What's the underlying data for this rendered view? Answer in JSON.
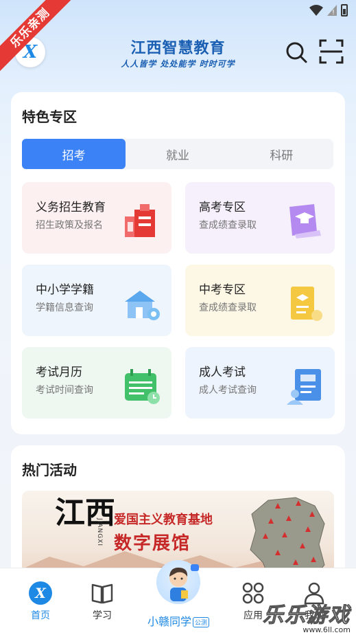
{
  "ribbon": "乐乐亲测",
  "header": {
    "title": "江西智慧教育",
    "slogan": "人人皆学 处处能学 时时可学",
    "logo_glyph": "X"
  },
  "features": {
    "title": "特色专区",
    "tabs": [
      {
        "label": "招考",
        "active": true
      },
      {
        "label": "就业",
        "active": false
      },
      {
        "label": "科研",
        "active": false
      }
    ],
    "tiles": [
      {
        "title": "义务招生教育",
        "subtitle": "招生政策及报名",
        "icon": "school-building-icon"
      },
      {
        "title": "高考专区",
        "subtitle": "查成绩查录取",
        "icon": "graduation-book-icon"
      },
      {
        "title": "中小学学籍",
        "subtitle": "学籍信息查询",
        "icon": "house-icon"
      },
      {
        "title": "中考专区",
        "subtitle": "查成绩查录取",
        "icon": "certificate-icon"
      },
      {
        "title": "考试月历",
        "subtitle": "考试时间查询",
        "icon": "calendar-icon"
      },
      {
        "title": "成人考试",
        "subtitle": "成人考试查询",
        "icon": "id-card-icon"
      }
    ]
  },
  "hot": {
    "title": "热门活动",
    "banner": {
      "calligraphy": "江西",
      "pinyin": "JIANGXI",
      "line1": "爱国主义教育基地",
      "line2": "数字展馆"
    }
  },
  "nav": {
    "home": "首页",
    "study": "学习",
    "assistant": "小赣同学",
    "assistant_tag": "公测",
    "apps": "应用",
    "mine": "我的"
  },
  "watermark": {
    "main": "乐乐游戏",
    "url": "www.6ll.com"
  },
  "colors": {
    "accent": "#3b82f6",
    "brand": "#1b5fb3",
    "ribbon": "#e53935"
  }
}
